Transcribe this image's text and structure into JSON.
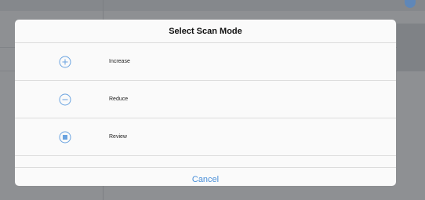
{
  "dialog": {
    "title": "Select Scan Mode",
    "options": [
      {
        "label": "Increase",
        "icon": "plus-circle-icon"
      },
      {
        "label": "Reduce",
        "icon": "minus-circle-icon"
      },
      {
        "label": "Review",
        "icon": "review-square-icon"
      }
    ],
    "cancel_label": "Cancel"
  },
  "colors": {
    "accent": "#4a8fd8",
    "overlay_bg": "#8e9093",
    "dialog_bg": "#fafafa"
  }
}
